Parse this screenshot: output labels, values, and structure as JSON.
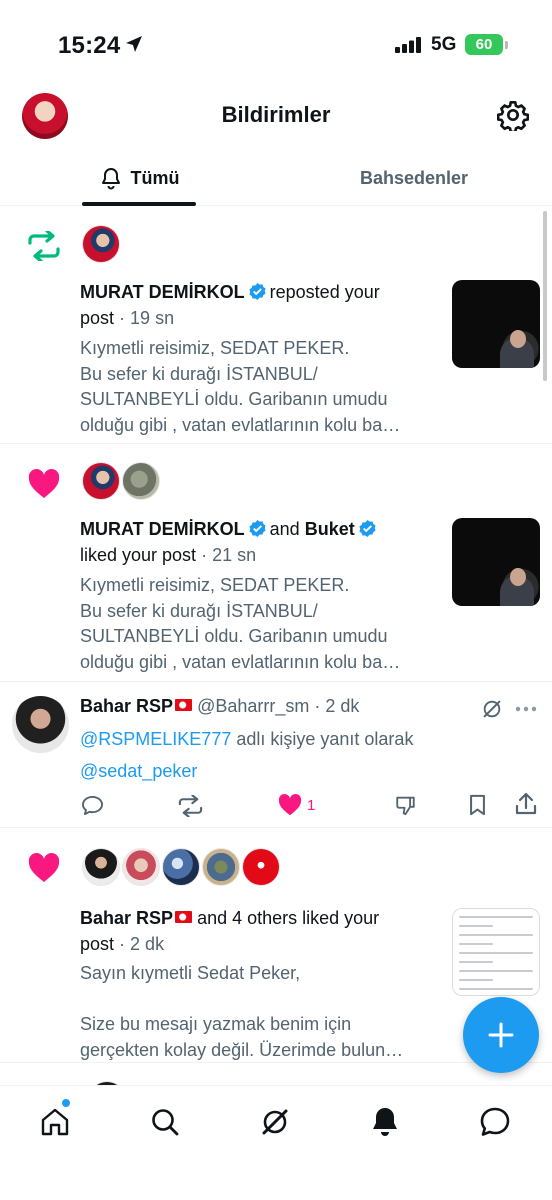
{
  "status": {
    "time": "15:24",
    "network": "5G",
    "battery": "60"
  },
  "header": {
    "title": "Bildirimler"
  },
  "tabs": [
    {
      "label": "Tümü"
    },
    {
      "label": "Bahsedenler"
    }
  ],
  "notifications": [
    {
      "type": "repost",
      "actor": "MURAT DEMİRKOL",
      "action": "reposted your",
      "action2": "post",
      "time": "· 19 sn",
      "preview": "Kıymetli reisimiz, SEDAT PEKER.\nBu sefer ki durağı İSTANBUL/\nSULTANBEYLİ oldu. Garibanın umudu\nolduğu gibi , vatan evlatlarının kolu ba…"
    },
    {
      "type": "like",
      "actor": "MURAT DEMİRKOL",
      "and": "and",
      "actor2": "Buket",
      "action": "liked your post",
      "time": "· 21 sn",
      "preview": "Kıymetli reisimiz, SEDAT PEKER.\nBu sefer ki durağı İSTANBUL/\nSULTANBEYLİ oldu. Garibanın umudu\nolduğu gibi , vatan evlatlarının kolu ba…"
    },
    {
      "type": "like",
      "actor": "Bahar RSP",
      "action": "and 4 others liked your",
      "action2": "post",
      "time": "· 2 dk",
      "preview": "Sayın kıymetli Sedat Peker,\n\nSize bu mesajı yazmak benim için\ngerçekten kolay değil. Üzerimde bulun…"
    }
  ],
  "tweet": {
    "name": "Bahar RSP",
    "handle": "@Baharrr_sm",
    "time": "· 2 dk",
    "reply_mention": "@RSPMELIKE777",
    "reply_text": "adlı kişiye yanıt olarak",
    "body_link": "@sedat_peker",
    "like_count": "1"
  },
  "colors": {
    "accent": "#1d9bf0",
    "like": "#f91880",
    "repost": "#00ba7c"
  }
}
